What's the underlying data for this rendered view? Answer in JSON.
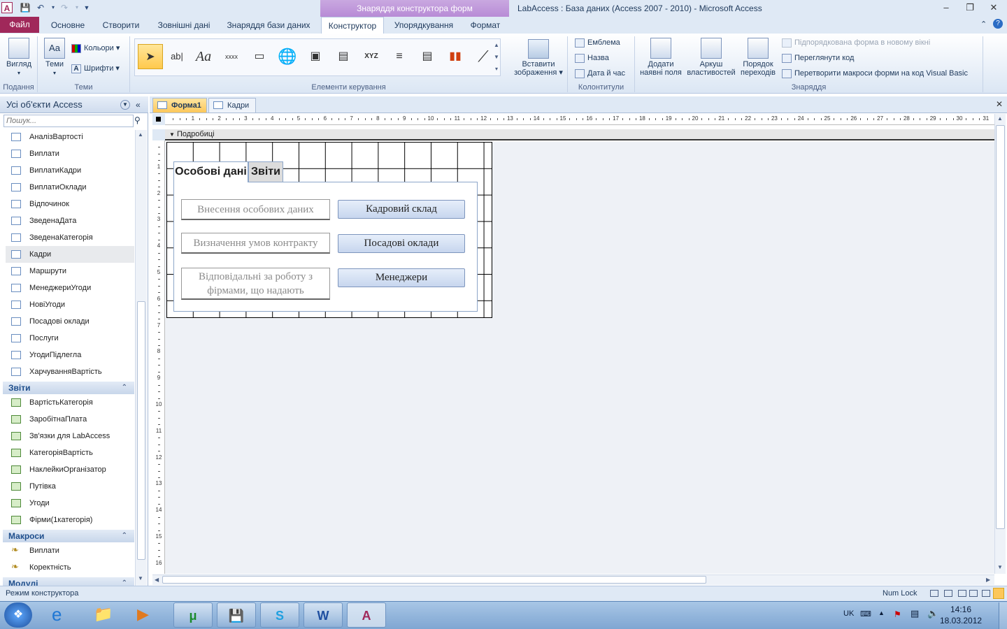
{
  "window": {
    "title": "LabAccess : База даних (Access 2007 - 2010)  -  Microsoft Access",
    "context_tab": "Знаряддя конструктора форм"
  },
  "ribbon_tabs": [
    "Файл",
    "Основне",
    "Створити",
    "Зовнішні дані",
    "Знаряддя бази даних",
    "Конструктор",
    "Упорядкування",
    "Формат"
  ],
  "ribbon": {
    "views": {
      "view_label": "Вигляд",
      "group": "Подання"
    },
    "themes": {
      "themes_label": "Теми",
      "colors_label": "Кольори",
      "fonts_label": "Шрифти",
      "group": "Теми"
    },
    "controls": {
      "group": "Елементи керування",
      "insert_image": "Вставити зображення",
      "ab_text": "ab|",
      "aa_text": "Aa",
      "xxxx_text": "xxxx",
      "xyz_text": "XYZ"
    },
    "header_footer": {
      "logo": "Емблема",
      "title": "Назва",
      "date_time": "Дата й час",
      "group": "Колонтитули"
    },
    "tools": {
      "add_fields": "Додати наявні поля",
      "property_sheet": "Аркуш властивостей",
      "tab_order": "Порядок переходів",
      "subform_new_window": "Підпорядкована форма в новому вікні",
      "view_code": "Переглянути код",
      "convert_macros": "Перетворити макроси форми на код Visual Basic",
      "group": "Знаряддя"
    }
  },
  "nav": {
    "header": "Усі об'єкти Access",
    "search_placeholder": "Пошук...",
    "forms": [
      "АналізВартості",
      "Виплати",
      "ВиплатиКадри",
      "ВиплатиОклади",
      "Відпочинок",
      "ЗведенаДата",
      "ЗведенаКатегорія",
      "Кадри",
      "Маршрути",
      "МенеджериУгоди",
      "НовіУгоди",
      "Посадові оклади",
      "Послуги",
      "УгодиПідлегла",
      "ХарчуванняВартість"
    ],
    "reports_title": "Звіти",
    "reports": [
      "ВартістьКатегорія",
      "ЗаробітнаПлата",
      "Зв'язки для LabAccess",
      "КатегоріяВартість",
      "НаклейкиОрганізатор",
      "Путівка",
      "Угоди",
      "Фірми(1категорія)"
    ],
    "macros_title": "Макроси",
    "macros": [
      "Виплати",
      "Коректність"
    ],
    "modules_title": "Модулі"
  },
  "doc_tabs": [
    "Форма1",
    "Кадри"
  ],
  "ruler": {
    "h_ticks": [
      "1",
      "2",
      "3",
      "4",
      "5",
      "6",
      "7",
      "8",
      "9",
      "10",
      "11",
      "12",
      "13",
      "14",
      "15",
      "16",
      "17",
      "18",
      "19",
      "20",
      "21",
      "22",
      "23",
      "24",
      "25",
      "26",
      "27",
      "28",
      "29",
      "30",
      "31"
    ],
    "v_ticks": [
      "1",
      "2",
      "3",
      "4",
      "5",
      "6",
      "7",
      "8",
      "9",
      "10",
      "11",
      "12",
      "13",
      "14",
      "15",
      "16"
    ]
  },
  "section_label": "Подробиці",
  "form": {
    "tabs": [
      "Особові дані",
      "Звіти"
    ],
    "labels": [
      "Внесення особових даних",
      "Визначення умов контракту",
      "Відповідальні за роботу з фірмами, що надають"
    ],
    "buttons": [
      "Кадровий склад",
      "Посадові оклади",
      "Менеджери"
    ]
  },
  "status": {
    "mode": "Режим конструктора",
    "numlock": "Num Lock"
  },
  "taskbar": {
    "lang": "UK",
    "time": "14:16",
    "date": "18.03.2012"
  }
}
